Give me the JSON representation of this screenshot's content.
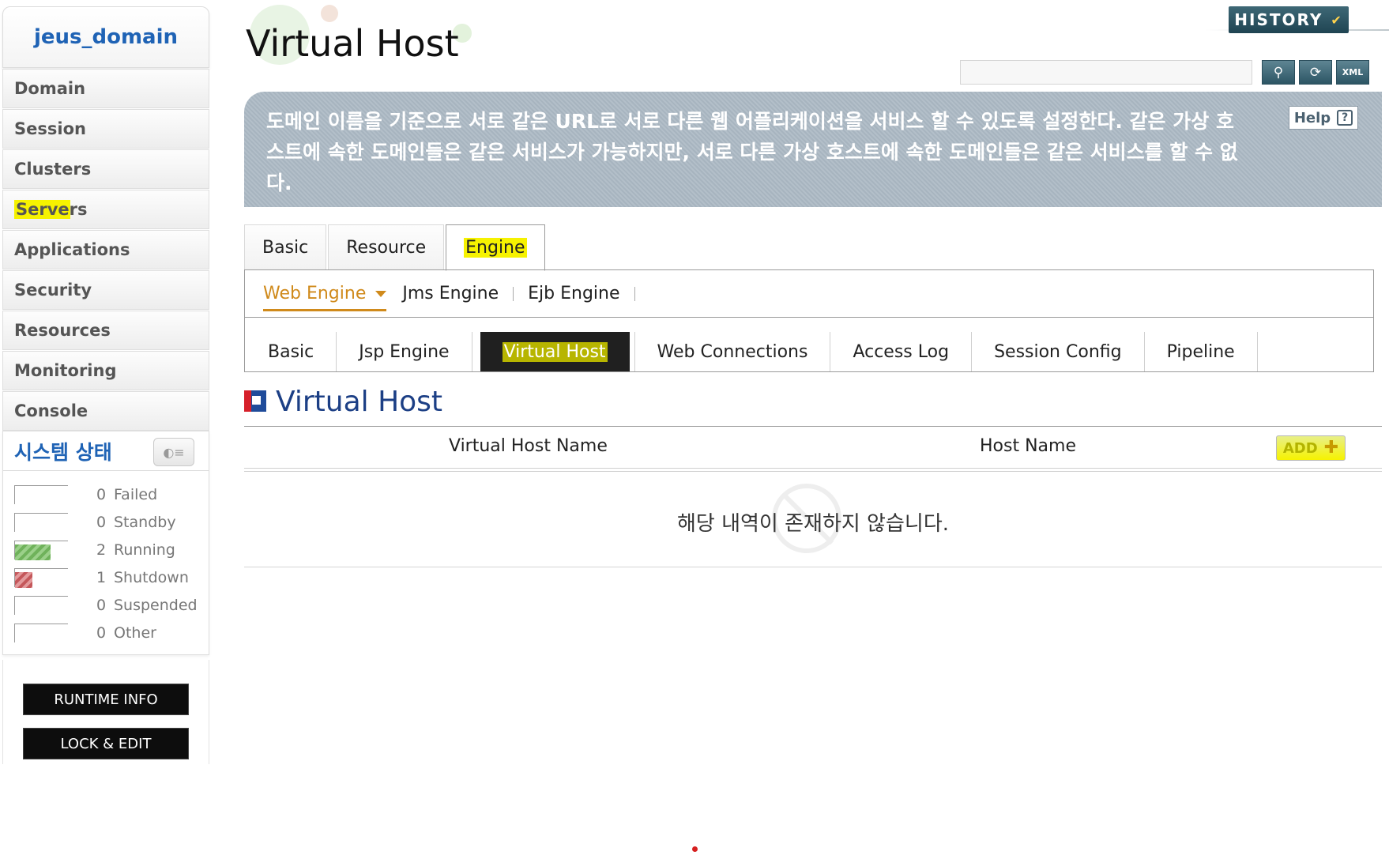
{
  "sidebar": {
    "domain": "jeus_domain",
    "nav": [
      "Domain",
      "Session",
      "Clusters",
      "Servers",
      "Applications",
      "Security",
      "Resources",
      "Monitoring",
      "Console"
    ],
    "status_title": "시스템 상태",
    "status": [
      {
        "count": "0",
        "label": "Failed",
        "fill": 0
      },
      {
        "count": "0",
        "label": "Standby",
        "fill": 0
      },
      {
        "count": "2",
        "label": "Running",
        "fill": 0.67
      },
      {
        "count": "1",
        "label": "Shutdown",
        "fill": 0.33
      },
      {
        "count": "0",
        "label": "Suspended",
        "fill": 0
      },
      {
        "count": "0",
        "label": "Other",
        "fill": 0
      }
    ],
    "runtime_info": "RUNTIME INFO",
    "lock_edit": "LOCK & EDIT"
  },
  "header": {
    "title": "Virtual Host",
    "history": "HISTORY",
    "search_value": "",
    "tools": [
      "search-icon",
      "refresh-icon",
      "xml-icon"
    ]
  },
  "description": {
    "text": "도메인 이름을 기준으로 서로 같은 URL로 서로 다른 웹 어플리케이션을 서비스 할 수 있도록 설정한다. 같은 가상 호스트에 속한 도메인들은 같은 서비스가 가능하지만, 서로 다른 가상 호스트에 속한 도메인들은 같은 서비스를 할 수 없다.",
    "help": "Help",
    "help_q": "?"
  },
  "tabs_l1": [
    {
      "label": "Basic"
    },
    {
      "label": "Resource"
    },
    {
      "label": "Engine",
      "active": true
    }
  ],
  "tabs_l2": [
    {
      "label": "Web Engine",
      "active": true
    },
    {
      "label": "Jms Engine"
    },
    {
      "label": "Ejb Engine"
    }
  ],
  "tabs_l3": [
    {
      "label": "Basic"
    },
    {
      "label": "Jsp Engine"
    },
    {
      "label": "Virtual Host",
      "active": true
    },
    {
      "label": "Web Connections"
    },
    {
      "label": "Access Log"
    },
    {
      "label": "Session Config"
    },
    {
      "label": "Pipeline"
    }
  ],
  "section": {
    "title": "Virtual Host",
    "columns": [
      "Virtual Host Name",
      "Host Name"
    ],
    "add": "ADD",
    "empty": "해당 내역이 존재하지 않습니다."
  },
  "colors": {
    "accent_blue": "#1f63b5",
    "highlight": "#f6f200",
    "active_orange": "#d08a1b"
  }
}
